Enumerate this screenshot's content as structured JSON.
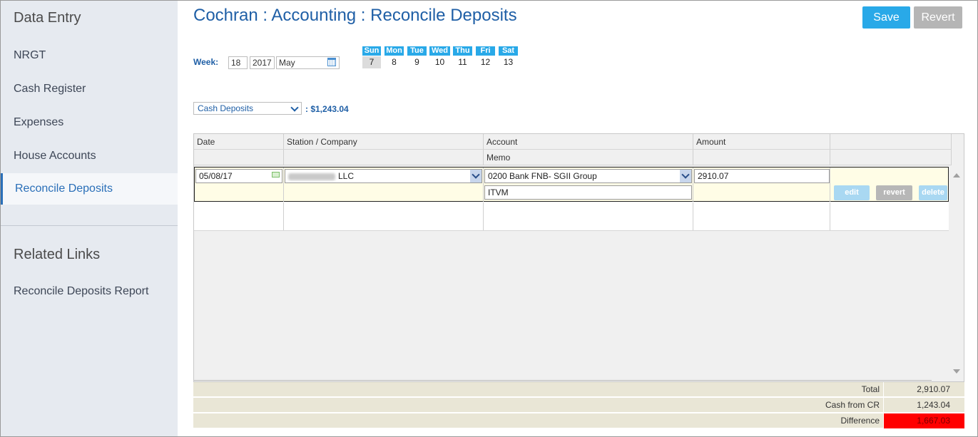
{
  "sidebar": {
    "section1_title": "Data Entry",
    "items": [
      {
        "label": "NRGT"
      },
      {
        "label": "Cash Register"
      },
      {
        "label": "Expenses"
      },
      {
        "label": "House Accounts"
      },
      {
        "label": "Reconcile Deposits",
        "active": true
      }
    ],
    "section2_title": "Related Links",
    "links": [
      {
        "label": "Reconcile Deposits Report"
      }
    ]
  },
  "header": {
    "title": "Cochran : Accounting : Reconcile Deposits",
    "save_label": "Save",
    "revert_label": "Revert"
  },
  "week": {
    "label": "Week:",
    "week_num": "18",
    "year": "2017",
    "month": "May",
    "days": [
      {
        "name": "Sun",
        "num": "7",
        "selected": true
      },
      {
        "name": "Mon",
        "num": "8"
      },
      {
        "name": "Tue",
        "num": "9"
      },
      {
        "name": "Wed",
        "num": "10"
      },
      {
        "name": "Thu",
        "num": "11"
      },
      {
        "name": "Fri",
        "num": "12"
      },
      {
        "name": "Sat",
        "num": "13"
      }
    ]
  },
  "deposit_type": {
    "selected": "Cash Deposits",
    "total": ": $1,243.04"
  },
  "grid": {
    "columns": {
      "date": "Date",
      "station": "Station / Company",
      "account": "Account",
      "memo": "Memo",
      "amount": "Amount"
    },
    "rows": [
      {
        "date": "05/08/17",
        "station_suffix": "LLC",
        "account": "0200 Bank FNB- SGII Group",
        "amount": "2910.07",
        "memo": "ITVM",
        "actions": {
          "edit": "edit",
          "revert": "revert",
          "delete": "delete"
        }
      }
    ]
  },
  "totals": {
    "total_label": "Total",
    "total_value": "2,910.07",
    "cash_label": "Cash from CR",
    "cash_value": "1,243.04",
    "diff_label": "Difference",
    "diff_value": "1,667.03"
  },
  "colors": {
    "accent": "#29a9e8",
    "title": "#1f5fa6",
    "difference_bg": "#ff0000",
    "row_bg": "#fffde6"
  }
}
